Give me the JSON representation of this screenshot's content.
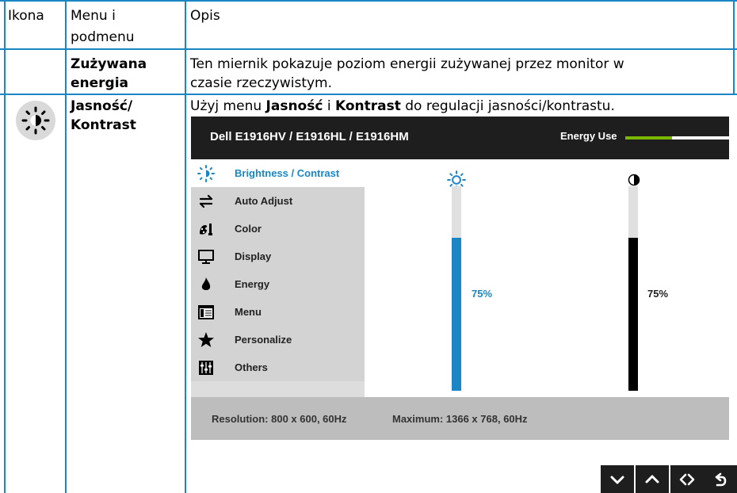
{
  "table": {
    "headers": [
      "Ikona",
      "Menu i",
      "podmenu",
      "Opis"
    ],
    "rows": [
      {
        "menu_line1": "Zużywana",
        "menu_line2": "energia",
        "desc_line1": "Ten miernik pokazuje poziom energii zużywanej przez monitor w",
        "desc_line2": "czasie rzeczywistym."
      },
      {
        "icon": "brightness-icon",
        "menu_line1": "Jasność/",
        "menu_line2": "Kontrast",
        "desc_part1": "Użyj menu ",
        "desc_bold1": "Jasność",
        "desc_part2": " i ",
        "desc_bold2": "Kontrast",
        "desc_part3": " do regulacji jasności/kontrastu."
      }
    ]
  },
  "osd": {
    "title": "Dell E1916HV / E1916HL / E1916HM",
    "energy_label": "Energy Use",
    "energy_level": 0.45,
    "menu_items": [
      {
        "label": "Brightness / Contrast",
        "icon": "brightness-icon",
        "active": true
      },
      {
        "label": "Auto Adjust",
        "icon": "auto-adjust-icon",
        "active": false
      },
      {
        "label": "Color",
        "icon": "color-icon",
        "active": false
      },
      {
        "label": "Display",
        "icon": "display-icon",
        "active": false
      },
      {
        "label": "Energy",
        "icon": "energy-icon",
        "active": false
      },
      {
        "label": "Menu",
        "icon": "menu-icon",
        "active": false
      },
      {
        "label": "Personalize",
        "icon": "star-icon",
        "active": false
      },
      {
        "label": "Others",
        "icon": "others-icon",
        "active": false
      }
    ],
    "brightness": {
      "value": 0.75,
      "label": "75%",
      "icon": "brightness-icon",
      "color": "#1a87c4"
    },
    "contrast": {
      "value": 0.75,
      "label": "75%",
      "icon": "contrast-icon",
      "color": "#000000"
    },
    "resolution": "Resolution: 800 x 600, 60Hz",
    "maximum": "Maximum: 1366 x 768, 60Hz"
  },
  "nav_buttons": [
    "chevron-down-icon",
    "chevron-up-icon",
    "left-right-icon",
    "back-icon"
  ],
  "colors": {
    "border": "#1a87c4",
    "accent": "#1a87c4",
    "energy": "#7ab800"
  }
}
